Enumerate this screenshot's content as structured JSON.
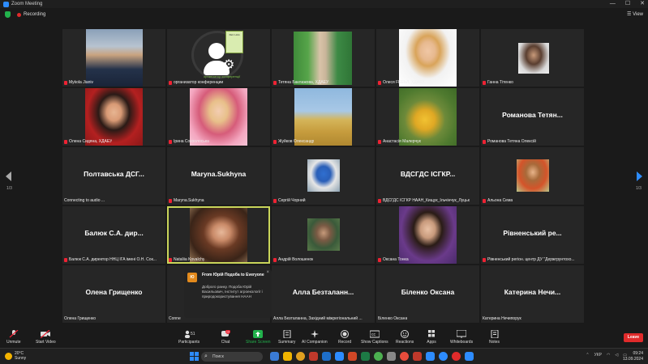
{
  "window": {
    "title": "Zoom Meeting",
    "controls": [
      "—",
      "☐",
      "✕"
    ]
  },
  "meeting": {
    "recording_label": "Recording",
    "view_label": "View"
  },
  "tiles": [
    {
      "name": "Mykola Jianiv",
      "muted": true
    },
    {
      "name": "организатор конференции",
      "muted": true,
      "tag": "організатор конференції",
      "logo_text": "ХЕС НАА"
    },
    {
      "name": "Тетяна Баклажова, ХДАЕУ",
      "muted": true
    },
    {
      "name": "Олеся FEEЬЛ, ХДАЕУ",
      "muted": true
    },
    {
      "name": "Ганна Тітенко",
      "muted": true
    },
    {
      "name": "Олена Сидяна, ХДАЕУ",
      "muted": true
    },
    {
      "name": "Ірина Сокоолоська",
      "muted": true
    },
    {
      "name": "Жуйков Олександр",
      "muted": true
    },
    {
      "name": "Анастасія Малерчук",
      "muted": true
    },
    {
      "name": "Романова Тетяна Олексій",
      "muted": true,
      "big": "Романова Тетян..."
    },
    {
      "name": "Connecting to audio ...",
      "muted": false,
      "big": "Полтавська ДСГ..."
    },
    {
      "name": "Maryna.Sukhyna",
      "muted": true,
      "big": "Maryna.Sukhyna"
    },
    {
      "name": "Сергій Чорний",
      "muted": true
    },
    {
      "name": "ВДСГДС ІСГКР НААН_Кищук_Ільчінчук_Луцьк",
      "muted": true,
      "big": "ВДСГДС ІСГКР..."
    },
    {
      "name": "Альона Сема",
      "muted": true
    },
    {
      "name": "Балюк С.А. директор ННЦ ІГА імені О.Н. Сок...",
      "muted": true,
      "big": "Балюк С.А. дир..."
    },
    {
      "name": "Nataliia Kovalchy",
      "muted": true,
      "active": true
    },
    {
      "name": "Андрій Волошенок",
      "muted": true
    },
    {
      "name": "Оксана Тонка",
      "muted": true
    },
    {
      "name": "Рівненський регіон. центр ДУ \"Держгрунтохо...",
      "muted": true,
      "big": "Рівненський ре..."
    },
    {
      "name": "Олена Грищенко",
      "muted": false,
      "big": "Олена Грищенко"
    },
    {
      "name": "Conne",
      "muted": false
    },
    {
      "name": "Алла Безталанна, Західний міжрегіональний ...",
      "muted": false,
      "big": "Алла Безталанн..."
    },
    {
      "name": "Біленко Оксана",
      "muted": false,
      "big": "Біленко Оксана"
    },
    {
      "name": "Катерина Нечипорук",
      "muted": false,
      "big": "Катерина Нечи..."
    }
  ],
  "pagination": {
    "left": "1/3",
    "right": "1/3"
  },
  "chat_popup": {
    "initial": "Ю",
    "title": "From Юрій Подоба to Everyone",
    "message": "Доброго ранку. Подоба Юрій Васильович, Інститут агроекології і природокористування НААН"
  },
  "toolbar": {
    "unmute": "Unmute",
    "start_video": "Start Video",
    "participants": "Participants",
    "participants_count": "51",
    "chat": "Chat",
    "chat_badge": "13",
    "share_screen": "Share Screen",
    "summary": "Summary",
    "ai_companion": "AI Companion",
    "record": "Record",
    "captions": "Show Captions",
    "reactions": "Reactions",
    "apps": "Apps",
    "whiteboards": "Whiteboards",
    "notes": "Notes",
    "leave": "Leave"
  },
  "taskbar": {
    "temperature": "20°C",
    "weather": "Sunny",
    "search_placeholder": "Поиск",
    "language": "УКР",
    "time": "09:24",
    "date": "13.09.2024"
  },
  "colors": {
    "accent": "#2d8cff",
    "leave": "#e02b2b",
    "active_speaker": "#c9d55a",
    "share": "#22b14c"
  }
}
